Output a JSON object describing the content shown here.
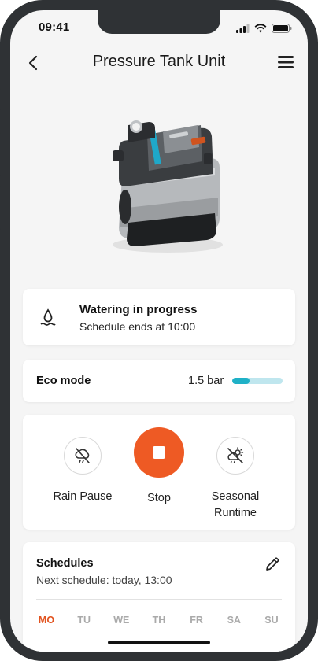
{
  "status_bar": {
    "time": "09:41"
  },
  "header": {
    "title": "Pressure Tank Unit"
  },
  "status_card": {
    "title": "Watering in progress",
    "subtitle": "Schedule ends at 10:00",
    "icon": "water-drop-icon"
  },
  "eco": {
    "label": "Eco mode",
    "value": "1.5 bar",
    "level": 0.35,
    "accent": "#1fb1c7"
  },
  "actions": {
    "rain_pause": "Rain Pause",
    "stop": "Stop",
    "seasonal_line1": "Seasonal",
    "seasonal_line2": "Runtime",
    "stop_color": "#ee5a24"
  },
  "schedules": {
    "title": "Schedules",
    "next": "Next schedule: today, 13:00",
    "days": [
      "MO",
      "TU",
      "WE",
      "TH",
      "FR",
      "SA",
      "SU"
    ],
    "active_day": "MO",
    "active_color": "#e2531f"
  }
}
